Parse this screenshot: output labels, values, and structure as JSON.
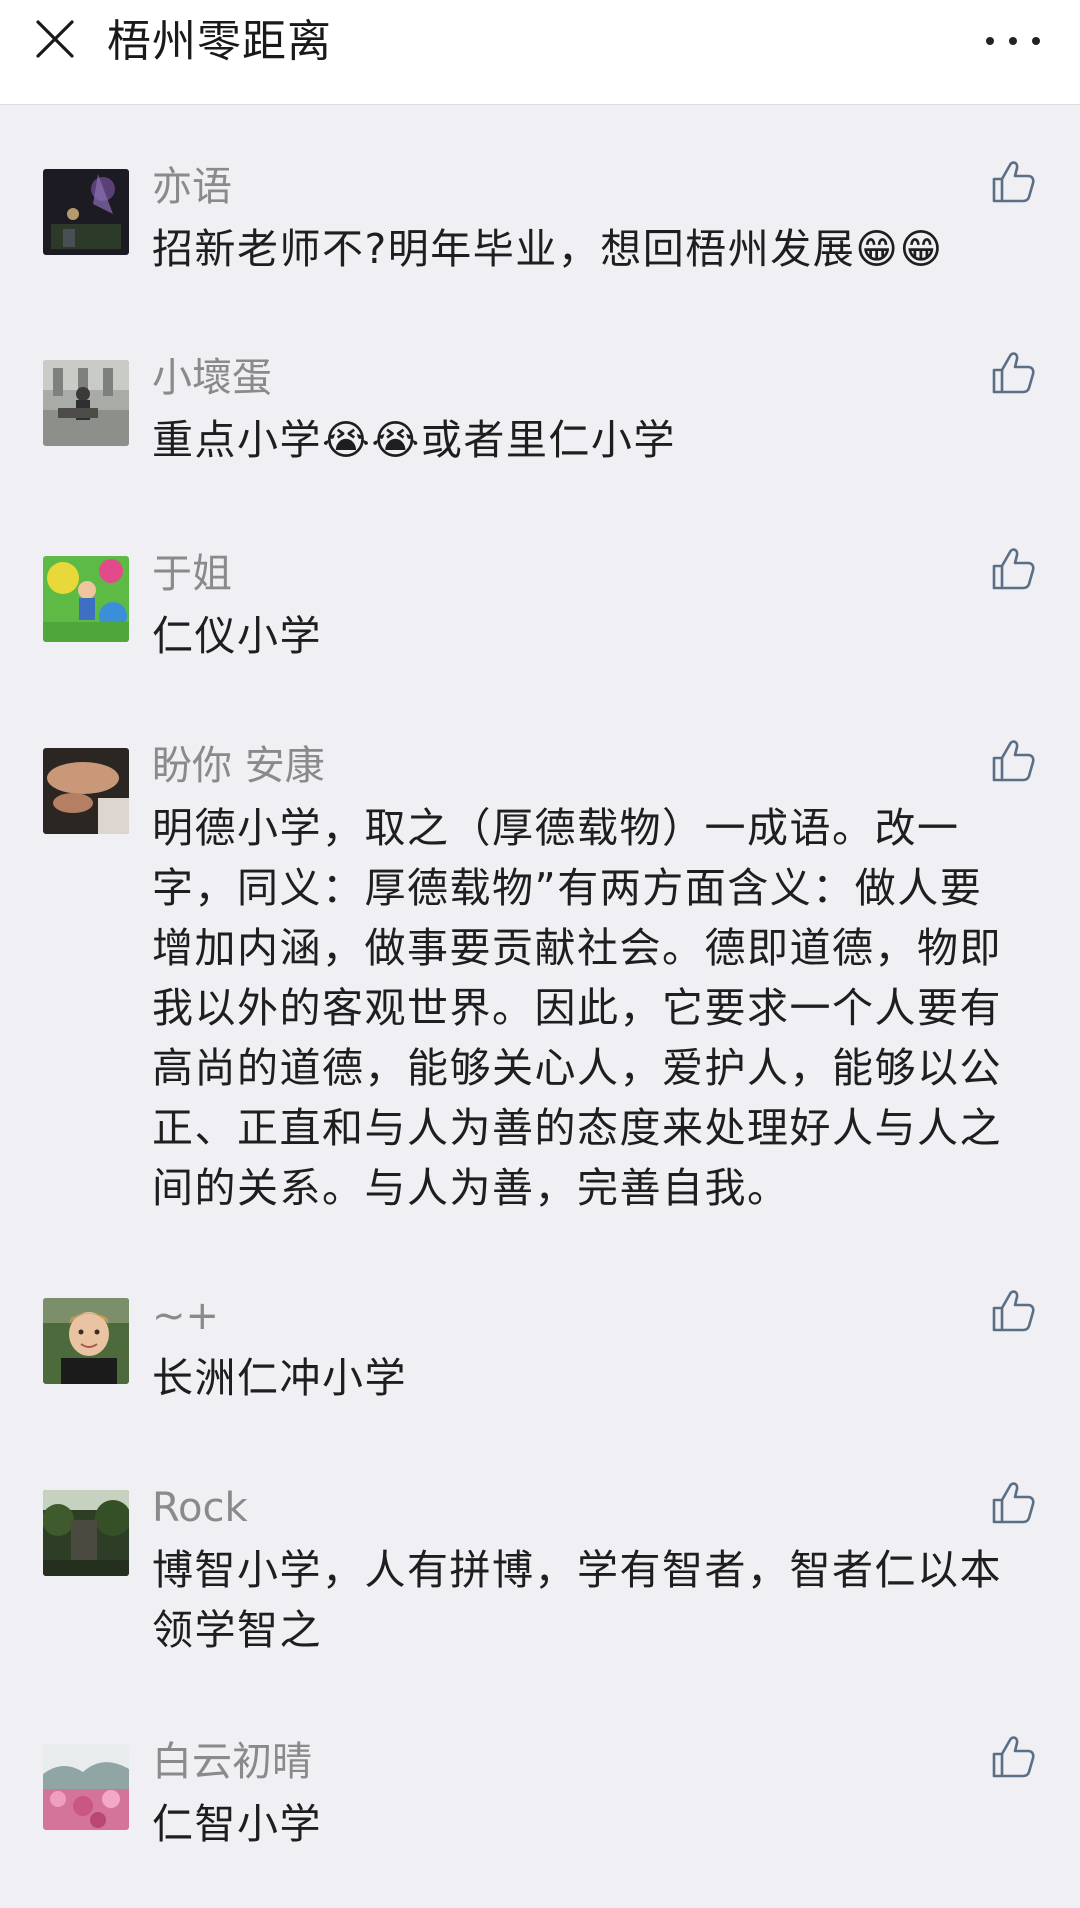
{
  "header": {
    "title": "梧州零距离",
    "close_icon": "close-icon",
    "more_icon": "more-dots-icon"
  },
  "colors": {
    "background": "#efeff4",
    "header_bg": "#ffffff",
    "name": "#8a8a8a",
    "text": "#1e1e1e",
    "like_icon": "#5a6e85"
  },
  "comments": [
    {
      "name": "亦语",
      "text": "招新老师不?明年毕业，想回梧州发展😁😁",
      "avatar": "night-scene-avatar"
    },
    {
      "name": "小壞蛋",
      "text": "重点小学😭😭或者里仁小学",
      "avatar": "building-avatar"
    },
    {
      "name": "于姐",
      "text": "仁仪小学",
      "avatar": "child-playground-avatar"
    },
    {
      "name": "盼你 安康",
      "text": "明德小学，取之（厚德载物）一成语。改一字，同义：厚德载物”有两方面含义：做人要增加内涵，做事要贡献社会。德即道德，物即我以外的客观世界。因此，它要求一个人要有高尚的道德，能够关心人，爱护人，能够以公正、正直和与人为善的态度来处理好人与人之间的关系。与人为善，完善自我。",
      "avatar": "hand-photo-avatar"
    },
    {
      "name": "~+",
      "text": "长洲仁冲小学",
      "avatar": "boy-portrait-avatar"
    },
    {
      "name": "Rock",
      "text": "博智小学，人有拼博，学有智者，智者仁以本领学智之",
      "avatar": "garden-avatar"
    },
    {
      "name": "白云初晴",
      "text": "仁智小学",
      "avatar": "pink-flowers-avatar"
    }
  ]
}
